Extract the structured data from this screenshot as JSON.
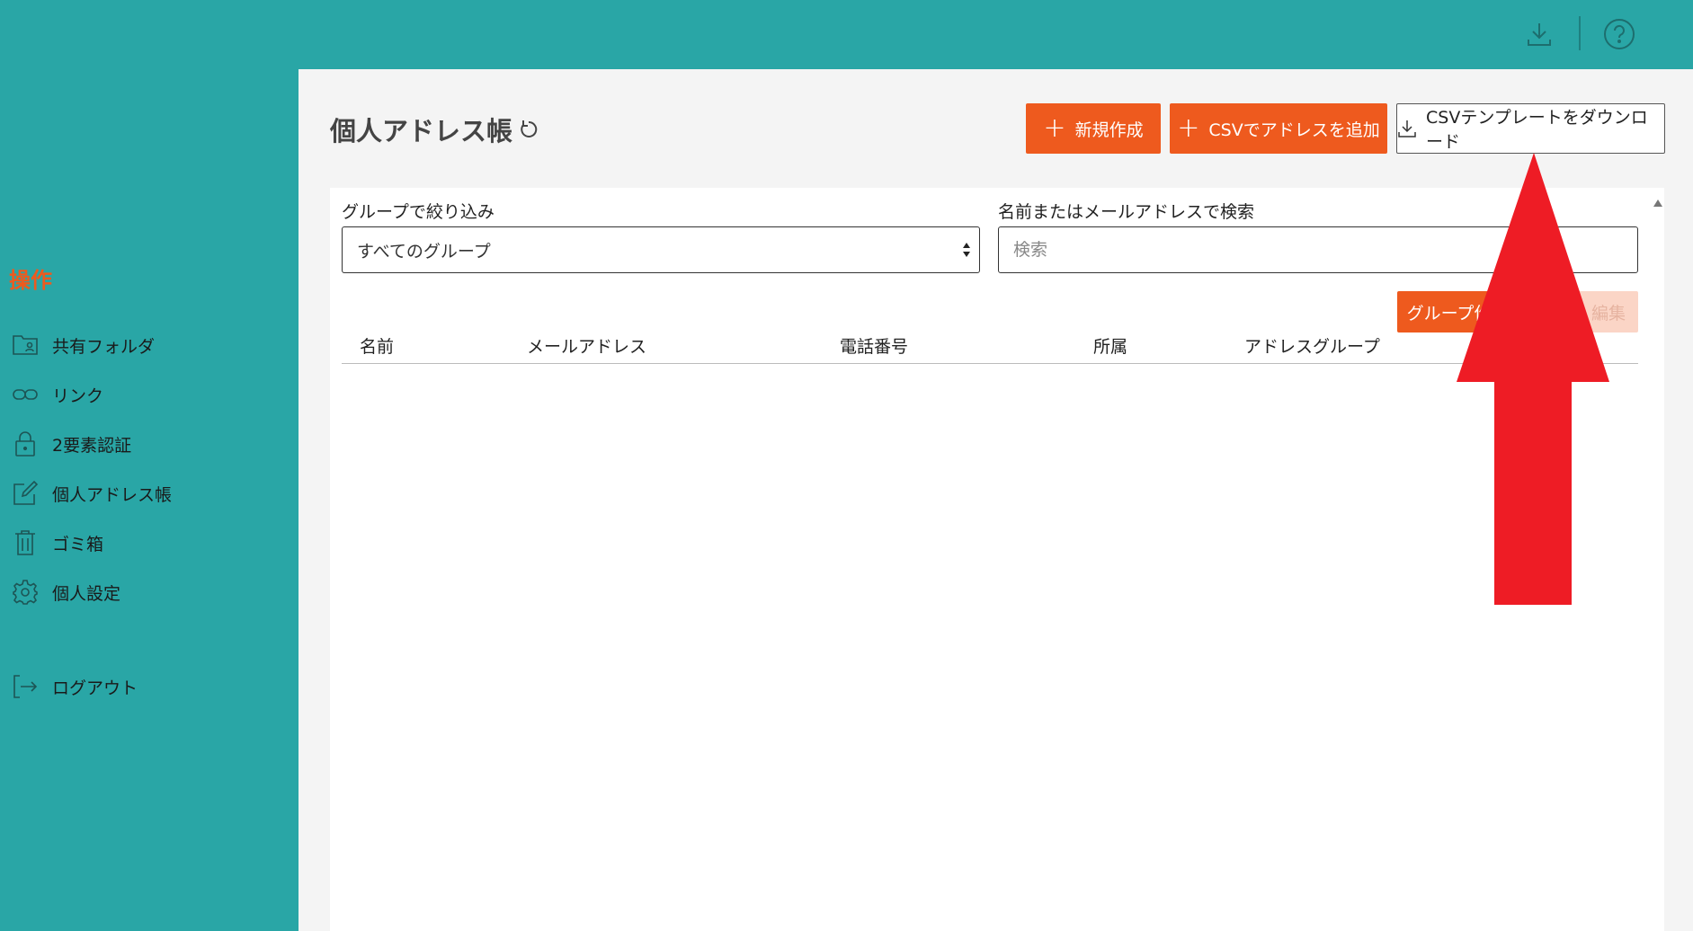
{
  "topbar": {
    "download_icon": "download-icon",
    "help_icon": "help-circle-icon"
  },
  "sidebar": {
    "heading": "操作",
    "items": [
      {
        "label": "共有フォルダ",
        "icon": "folder-user-icon"
      },
      {
        "label": "リンク",
        "icon": "link-icon"
      },
      {
        "label": "2要素認証",
        "icon": "lock-icon"
      },
      {
        "label": "個人アドレス帳",
        "icon": "edit-icon"
      },
      {
        "label": "ゴミ箱",
        "icon": "trash-icon"
      },
      {
        "label": "個人設定",
        "icon": "gear-icon"
      },
      {
        "label": "ログアウト",
        "icon": "logout-icon"
      }
    ]
  },
  "main": {
    "title": "個人アドレス帳",
    "buttons": {
      "new": "新規作成",
      "csv_add": "CSVでアドレスを追加",
      "csv_template": "CSVテンプレートをダウンロード"
    },
    "filter": {
      "group_label": "グループで絞り込み",
      "group_value": "すべてのグループ",
      "search_label": "名前またはメールアドレスで検索",
      "search_placeholder": "検索"
    },
    "group_buttons": {
      "create": "グループ作",
      "edit": "編集"
    },
    "table": {
      "columns": [
        "名前",
        "メールアドレス",
        "電話番号",
        "所属",
        "アドレスグループ"
      ],
      "rows": []
    }
  },
  "colors": {
    "teal": "#29a6a6",
    "orange": "#ee5a1e",
    "annotation_arrow": "#ee1c25"
  }
}
